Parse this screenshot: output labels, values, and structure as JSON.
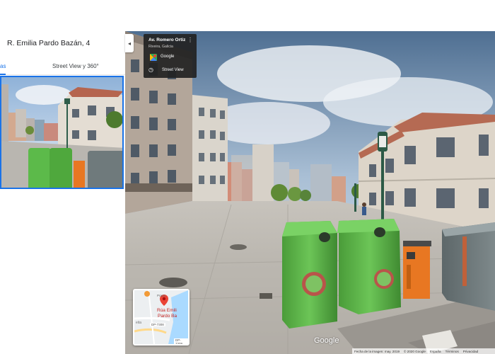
{
  "place": {
    "title": "R. Emilia Pardo Bazán, 4"
  },
  "tabs": {
    "photos_partial": "as",
    "street_view": "Street View y 360°"
  },
  "collapse": {
    "glyph": "◂"
  },
  "card": {
    "title": "Av. Romero Ortiz",
    "subtitle": "Riveira, Galicia",
    "more": "⋮",
    "google": "Google",
    "clock": "◷",
    "street_view": "Street View"
  },
  "minimap": {
    "label_line1": "Rúa Emili",
    "label_line2": "Pardo Ba",
    "road1": "DP-7308",
    "road2": "DP-7309",
    "place": "Praza",
    "eita": "eita"
  },
  "google_logo": "Google",
  "footer": {
    "date": "Fecha de la imagen: may. 2019",
    "copyright": "© 2020 Google",
    "country": "España",
    "terms": "Términos",
    "privacy": "Privacidad"
  },
  "colors": {
    "accent": "#1a73e8",
    "container_green": "#5cba4a",
    "container_gray": "#6f7a7c",
    "bin_orange": "#e87722"
  }
}
